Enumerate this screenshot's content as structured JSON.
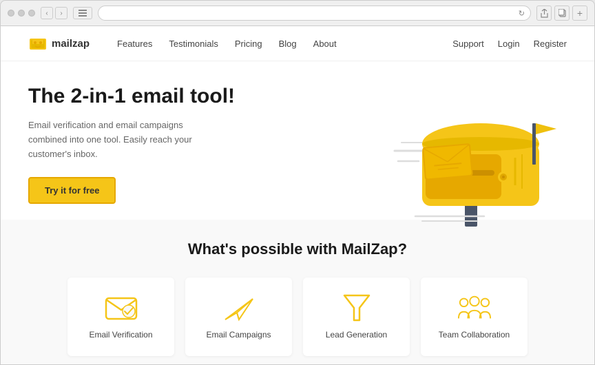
{
  "browser": {
    "address": ""
  },
  "navbar": {
    "logo_text": "mailzap",
    "links": [
      {
        "label": "Features"
      },
      {
        "label": "Testimonials"
      },
      {
        "label": "Pricing"
      },
      {
        "label": "Blog"
      },
      {
        "label": "About"
      }
    ],
    "right_links": [
      {
        "label": "Support"
      },
      {
        "label": "Login"
      },
      {
        "label": "Register"
      }
    ]
  },
  "hero": {
    "title": "The 2-in-1 email tool!",
    "subtitle": "Email verification and email campaigns combined into one tool. Easily reach your customer's inbox.",
    "cta": "Try it for free"
  },
  "features": {
    "section_title": "What's possible with MailZap?",
    "cards": [
      {
        "label": "Email Verification"
      },
      {
        "label": "Email Campaigns"
      },
      {
        "label": "Lead Generation"
      },
      {
        "label": "Team Collaboration"
      }
    ]
  }
}
